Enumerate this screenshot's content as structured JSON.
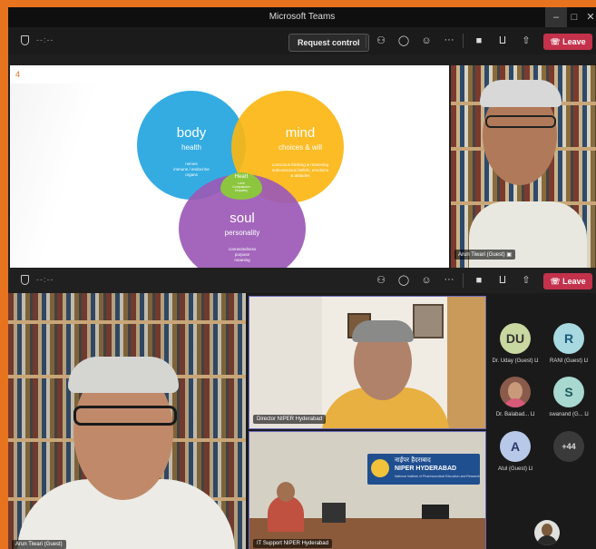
{
  "window": {
    "title": "Microsoft Teams",
    "minimize_icon": "minimize-icon",
    "maximize_icon": "maximize-icon",
    "close_icon": "close-icon"
  },
  "meeting_bar": {
    "timer": "--:--",
    "request_control_label": "Request control",
    "leave_label": "Leave",
    "icons": [
      "people-icon",
      "chat-icon",
      "reactions-icon",
      "more-icon",
      "camera-off-icon",
      "mic-off-icon",
      "share-icon"
    ]
  },
  "slide": {
    "number": "4",
    "circles": {
      "body": {
        "title": "body",
        "subtitle": "health",
        "detail": "nerves\nimmune / endocrine\norgans"
      },
      "mind": {
        "title": "mind",
        "subtitle": "choices & will",
        "detail": "conscious thinking & reasoning\nsubconscious beliefs, emotions\n& attitudes"
      },
      "soul": {
        "title": "soul",
        "subtitle": "personality",
        "detail": "connectedness\npurpose\nmeaning"
      },
      "heart": {
        "title": "Heart",
        "detail": "Love\nCompassion\nEmpathy"
      }
    },
    "colors": {
      "body": "#29a8df",
      "mind": "#fbb614",
      "soul": "#9b59b6",
      "heart": "#8cc63f"
    }
  },
  "participants": {
    "top_video": {
      "name": "Arun Tiwari (Guest)"
    },
    "main_video": {
      "name": "Arun Tiwari (Guest)"
    },
    "director": {
      "name": "Director NIPER Hyderabad"
    },
    "room": {
      "name": "IT Support NIPER Hyderabad",
      "banner_hindi": "नाईपर हैदराबाद",
      "banner_en": "NIPER HYDERABAD",
      "banner_sub": "National Institute of Pharmaceutical Education and Research"
    },
    "roster": [
      {
        "initials": "DU",
        "name": "Dr. Uday (Guest)",
        "color": "#c9d7a0"
      },
      {
        "initials": "R",
        "name": "RANI (Guest)",
        "color": "#a8d8e0"
      },
      {
        "initials": "",
        "name": "Dr. Balabad...",
        "color": "#8a5a4a"
      },
      {
        "initials": "S",
        "name": "swanand (G...",
        "color": "#a8d8d0"
      },
      {
        "initials": "A",
        "name": "Atul (Guest)",
        "color": "#b8c8e8"
      },
      {
        "initials": "+44",
        "name": "",
        "color": "#3a3a3a"
      }
    ]
  }
}
